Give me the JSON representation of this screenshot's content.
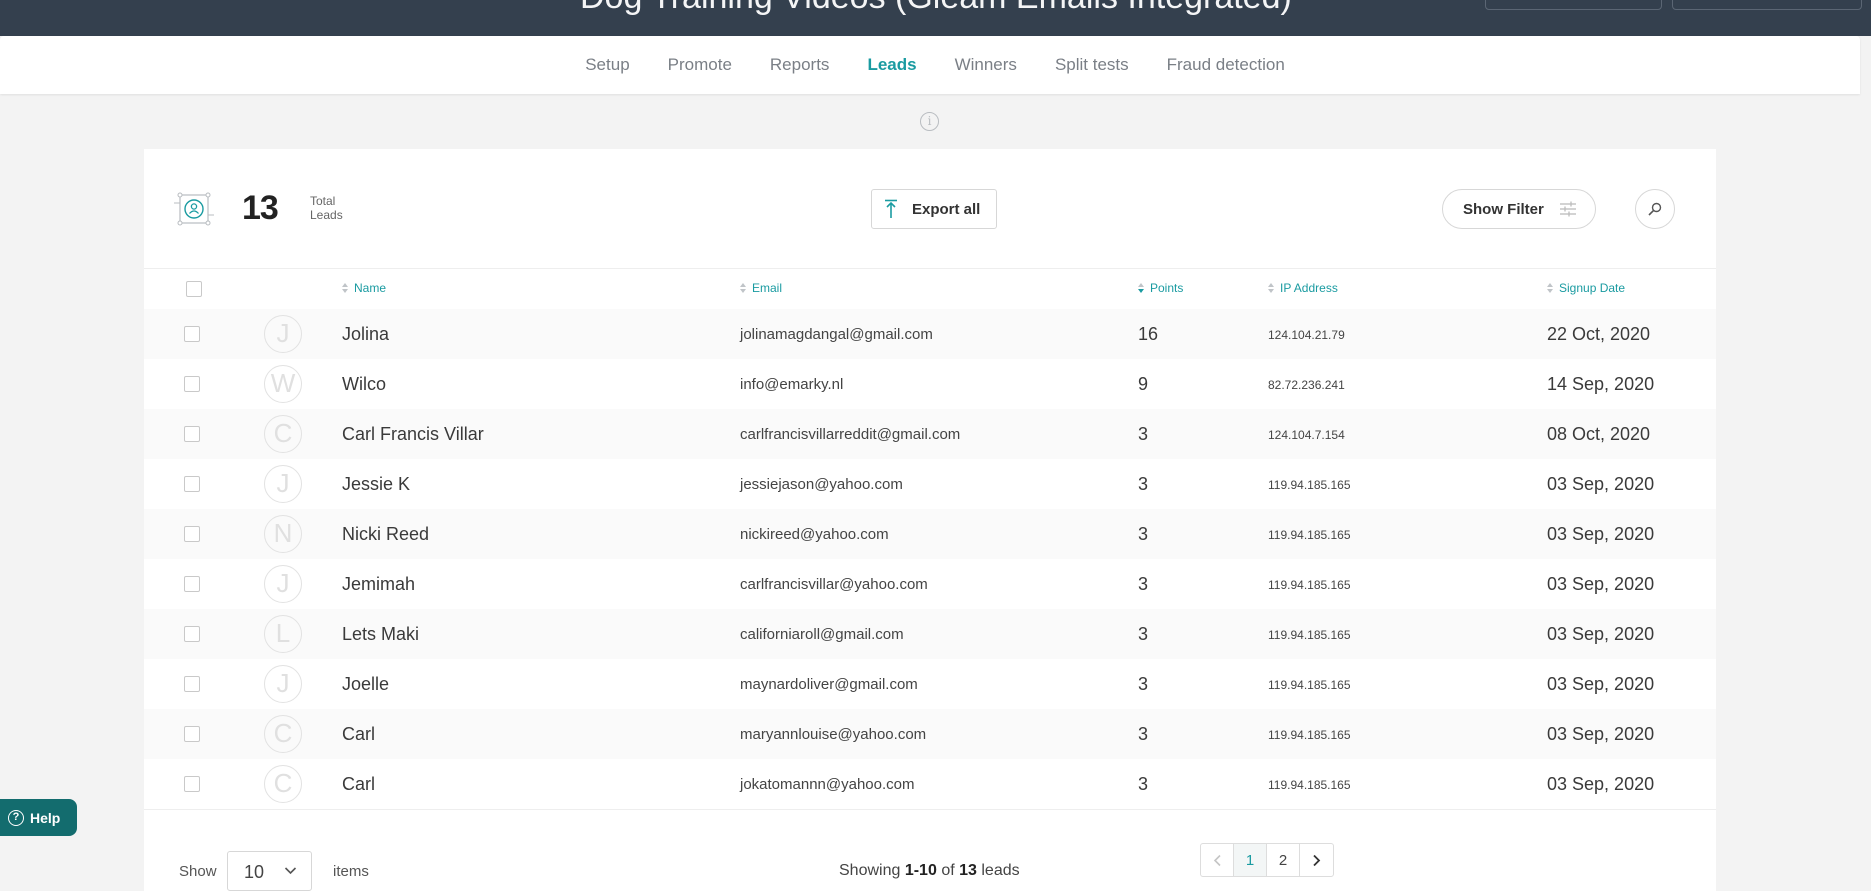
{
  "header": {
    "title": "Dog Training Videos (Gleam Emails Integrated)"
  },
  "nav": {
    "tabs": [
      {
        "label": "Setup"
      },
      {
        "label": "Promote"
      },
      {
        "label": "Reports"
      },
      {
        "label": "Leads",
        "active": true
      },
      {
        "label": "Winners"
      },
      {
        "label": "Split tests"
      },
      {
        "label": "Fraud detection"
      }
    ]
  },
  "summary": {
    "count": "13",
    "label_line1": "Total",
    "label_line2": "Leads",
    "export_label": "Export all",
    "filter_label": "Show Filter"
  },
  "table": {
    "columns": {
      "name": "Name",
      "email": "Email",
      "points": "Points",
      "ip": "IP Address",
      "signup": "Signup Date"
    },
    "sorted_by": "Points",
    "sort_direction": "descending",
    "rows": [
      {
        "initial": "J",
        "name": "Jolina",
        "email": "jolinamagdangal@gmail.com",
        "points": "16",
        "ip": "124.104.21.79",
        "date": "22 Oct, 2020"
      },
      {
        "initial": "W",
        "name": "Wilco",
        "email": "info@emarky.nl",
        "points": "9",
        "ip": "82.72.236.241",
        "date": "14 Sep, 2020"
      },
      {
        "initial": "C",
        "name": "Carl Francis Villar",
        "email": "carlfrancisvillarreddit@gmail.com",
        "points": "3",
        "ip": "124.104.7.154",
        "date": "08 Oct, 2020"
      },
      {
        "initial": "J",
        "name": "Jessie K",
        "email": "jessiejason@yahoo.com",
        "points": "3",
        "ip": "119.94.185.165",
        "date": "03 Sep, 2020"
      },
      {
        "initial": "N",
        "name": "Nicki Reed",
        "email": "nickireed@yahoo.com",
        "points": "3",
        "ip": "119.94.185.165",
        "date": "03 Sep, 2020"
      },
      {
        "initial": "J",
        "name": "Jemimah",
        "email": "carlfrancisvillar@yahoo.com",
        "points": "3",
        "ip": "119.94.185.165",
        "date": "03 Sep, 2020"
      },
      {
        "initial": "L",
        "name": "Lets Maki",
        "email": "californiaroll@gmail.com",
        "points": "3",
        "ip": "119.94.185.165",
        "date": "03 Sep, 2020"
      },
      {
        "initial": "J",
        "name": "Joelle",
        "email": "maynardoliver@gmail.com",
        "points": "3",
        "ip": "119.94.185.165",
        "date": "03 Sep, 2020"
      },
      {
        "initial": "C",
        "name": "Carl",
        "email": "maryannlouise@yahoo.com",
        "points": "3",
        "ip": "119.94.185.165",
        "date": "03 Sep, 2020"
      },
      {
        "initial": "C",
        "name": "Carl",
        "email": "jokatomannn@yahoo.com",
        "points": "3",
        "ip": "119.94.185.165",
        "date": "03 Sep, 2020"
      }
    ]
  },
  "footer": {
    "show_label": "Show",
    "page_size": "10",
    "items_label": "items",
    "showing_prefix": "Showing",
    "range": "1-10",
    "of_label": "of",
    "total": "13",
    "leads_label": "leads",
    "pages": [
      "1",
      "2"
    ],
    "current_page": "1"
  },
  "help": {
    "label": "Help"
  },
  "colors": {
    "accent": "#1a9ba1",
    "topbar": "#34404e",
    "help_bg": "#136c6e"
  }
}
